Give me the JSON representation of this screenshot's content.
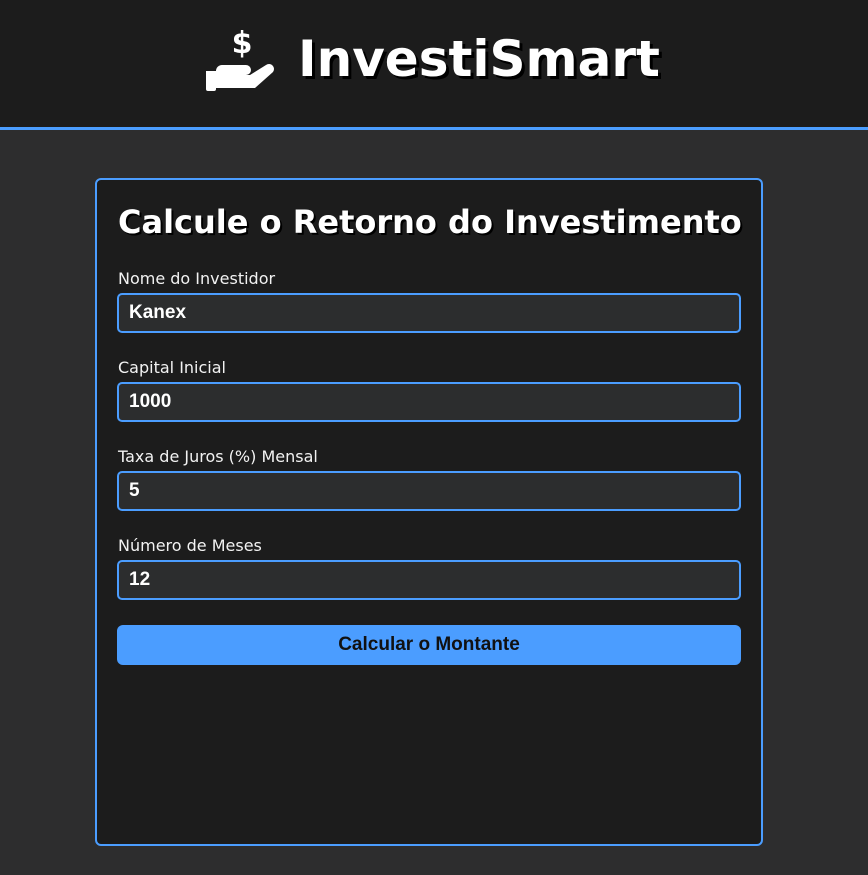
{
  "header": {
    "title": "InvestiSmart",
    "icon": "hand-holding-dollar-icon",
    "background": "#1c1c1c",
    "accent": "#4b9dff"
  },
  "form": {
    "title": "Calcule o Retorno do Investimento",
    "fields": [
      {
        "label": "Nome do Investidor",
        "value": "Kanex"
      },
      {
        "label": "Capital Inicial",
        "value": "1000"
      },
      {
        "label": "Taxa de Juros (%) Mensal",
        "value": "5"
      },
      {
        "label": "Número de Meses",
        "value": "12"
      }
    ],
    "submit_label": "Calcular o Montante"
  },
  "colors": {
    "page_background": "#2d2d2e",
    "card_background": "#1c1c1c",
    "border_accent": "#4b9dff",
    "button_background": "#4b9dff"
  }
}
